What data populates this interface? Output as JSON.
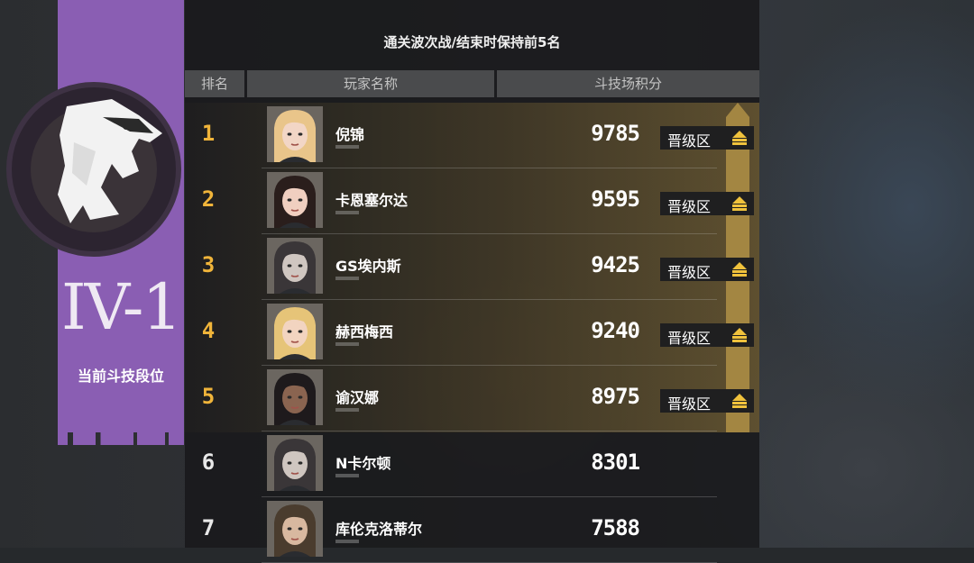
{
  "condition_text": "通关波次战/结束时保持前5名",
  "rank": {
    "tier": "IV-1",
    "label": "当前斗技段位",
    "color": "#8a5eb3"
  },
  "table": {
    "headers": {
      "rank": "排名",
      "player": "玩家名称",
      "score": "斗技场积分"
    },
    "promotion_label": "晋级区",
    "promotion_color": "#a38642",
    "rows": [
      {
        "rank": "1",
        "name": "倪锦",
        "score": "9785",
        "promotion": true,
        "hair": "#e9c58a",
        "skin": "#f2d6c6"
      },
      {
        "rank": "2",
        "name": "卡恩塞尔达",
        "score": "9595",
        "promotion": true,
        "hair": "#2a1e1c",
        "skin": "#f0cfc0"
      },
      {
        "rank": "3",
        "name": "GS埃内斯",
        "score": "9425",
        "promotion": true,
        "hair": "#3a3638",
        "skin": "#cfc6c0"
      },
      {
        "rank": "4",
        "name": "赫西梅西",
        "score": "9240",
        "promotion": true,
        "hair": "#e6c478",
        "skin": "#f2d4c0"
      },
      {
        "rank": "5",
        "name": "谕汉娜",
        "score": "8975",
        "promotion": true,
        "hair": "#1e1a1c",
        "skin": "#8a6450"
      },
      {
        "rank": "6",
        "name": "N卡尔顿",
        "score": "8301",
        "promotion": false,
        "hair": "#3a3638",
        "skin": "#cfc6c0"
      },
      {
        "rank": "7",
        "name": "库伦克洛蒂尔",
        "score": "7588",
        "promotion": false,
        "hair": "#4a3c2e",
        "skin": "#d8b8a0"
      }
    ]
  }
}
